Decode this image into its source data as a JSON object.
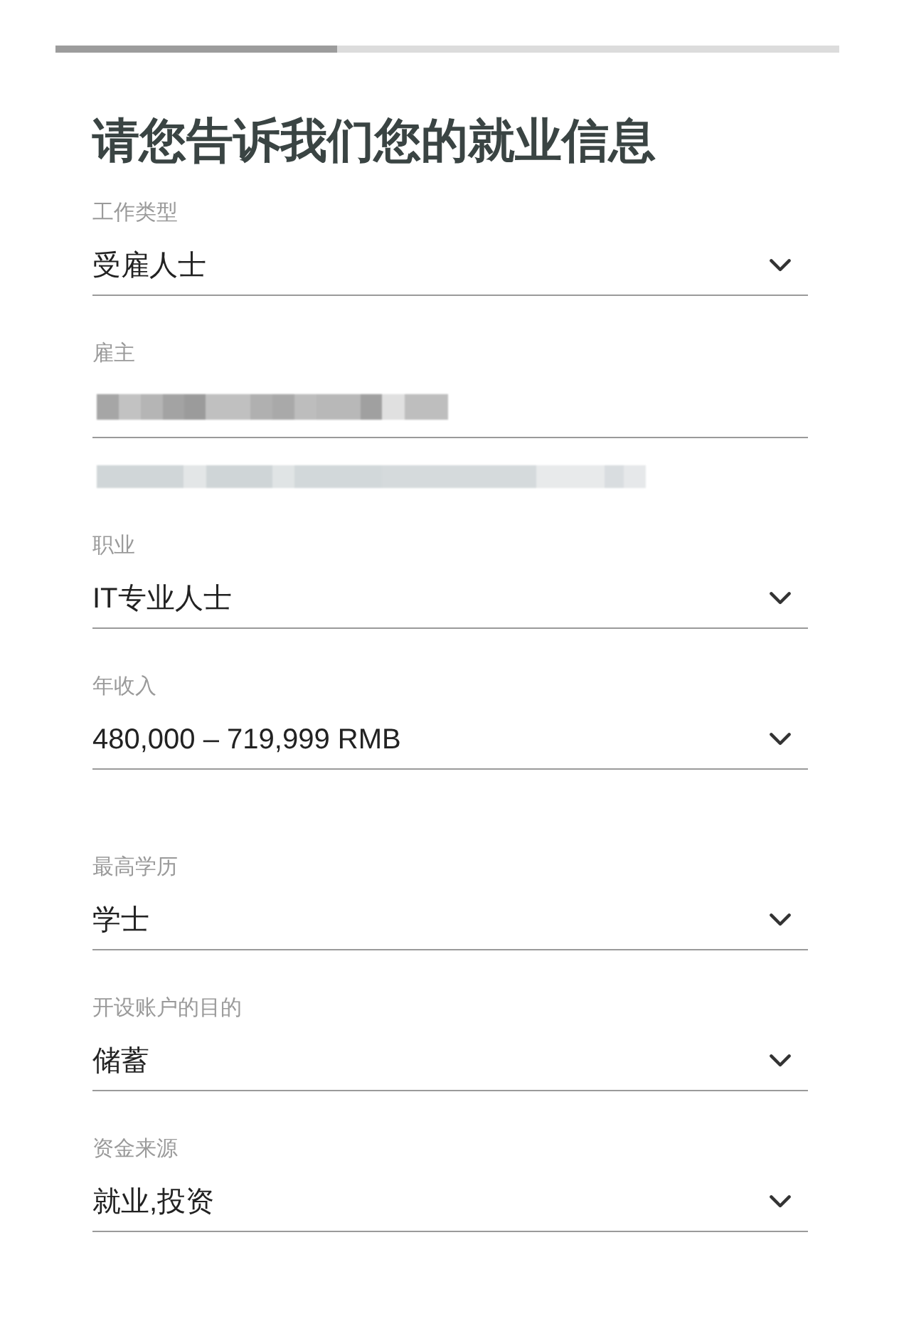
{
  "progress": {
    "level": 0.36
  },
  "title": "请您告诉我们您的就业信息",
  "sections": [
    {
      "fields": [
        {
          "kind": "select",
          "label": "工作类型",
          "value": "受雇人士"
        },
        {
          "kind": "text",
          "label": "雇主",
          "redacted": true
        },
        {
          "kind": "redacted_note"
        },
        {
          "kind": "select",
          "label": "职业",
          "value": "IT专业人士"
        },
        {
          "kind": "select",
          "label": "年收入",
          "value": "480,000 – 719,999 RMB"
        }
      ]
    },
    {
      "fields": [
        {
          "kind": "select",
          "label": "最高学历",
          "value": "学士"
        },
        {
          "kind": "select",
          "label": "开设账户的目的",
          "value": "储蓄"
        },
        {
          "kind": "select",
          "label": "资金来源",
          "value": "就业,投资"
        }
      ]
    }
  ]
}
